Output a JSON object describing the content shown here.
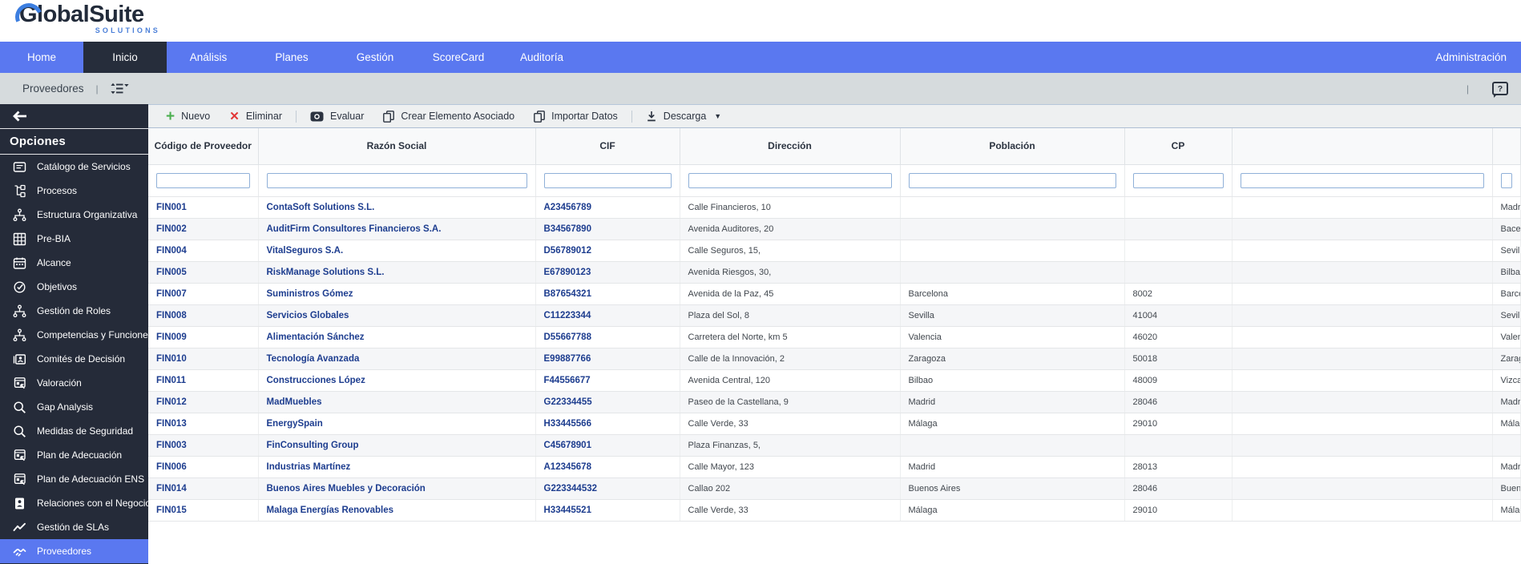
{
  "brand": {
    "name": "GlobalSuite",
    "tagline": "SOLUTIONS"
  },
  "nav": {
    "items": [
      {
        "label": "Home",
        "active": false
      },
      {
        "label": "Inicio",
        "active": true
      },
      {
        "label": "Análisis",
        "active": false
      },
      {
        "label": "Planes",
        "active": false
      },
      {
        "label": "Gestión",
        "active": false
      },
      {
        "label": "ScoreCard",
        "active": false
      },
      {
        "label": "Auditoría",
        "active": false
      }
    ],
    "right_item": "Administración"
  },
  "breadcrumb": {
    "title": "Proveedores"
  },
  "help": {
    "label": "?"
  },
  "toolbar": {
    "buttons": [
      {
        "label": "Nuevo",
        "icon": "plus-icon"
      },
      {
        "label": "Eliminar",
        "icon": "delete-x-icon"
      },
      {
        "label": "Evaluar",
        "icon": "evaluate-icon"
      },
      {
        "label": "Crear Elemento Asociado",
        "icon": "copy-icon"
      },
      {
        "label": "Importar Datos",
        "icon": "copy-icon"
      },
      {
        "label": "Descarga",
        "icon": "download-icon",
        "has_dropdown": true
      }
    ]
  },
  "sidebar": {
    "title": "Opciones",
    "items": [
      {
        "label": "Catálogo de Servicios",
        "icon": "document-icon",
        "selected": false
      },
      {
        "label": "Procesos",
        "icon": "flow-icon",
        "selected": false
      },
      {
        "label": "Estructura Organizativa",
        "icon": "people-tree-icon",
        "selected": false
      },
      {
        "label": "Pre-BIA",
        "icon": "grid-icon",
        "selected": false
      },
      {
        "label": "Alcance",
        "icon": "calendar-icon",
        "selected": false
      },
      {
        "label": "Objetivos",
        "icon": "target-icon",
        "selected": false
      },
      {
        "label": "Gestión de Roles",
        "icon": "people-tree-icon",
        "selected": false
      },
      {
        "label": "Competencias y Funciones",
        "icon": "people-tree-icon",
        "selected": false
      },
      {
        "label": "Comités de Decisión",
        "icon": "id-card-icon",
        "selected": false
      },
      {
        "label": "Valoración",
        "icon": "calendar-cursor-icon",
        "selected": false
      },
      {
        "label": "Gap Analysis",
        "icon": "search-icon",
        "selected": false
      },
      {
        "label": "Medidas de Seguridad",
        "icon": "search-icon",
        "selected": false
      },
      {
        "label": "Plan de Adecuación",
        "icon": "calendar-cursor-icon",
        "selected": false
      },
      {
        "label": "Plan de Adecuación ENS",
        "icon": "calendar-cursor-icon",
        "selected": false
      },
      {
        "label": "Relaciones con el Negocio",
        "icon": "person-badge-icon",
        "selected": false
      },
      {
        "label": "Gestión de SLAs",
        "icon": "trend-icon",
        "selected": false
      },
      {
        "label": "Proveedores",
        "icon": "handshake-icon",
        "selected": true
      }
    ]
  },
  "table": {
    "columns": [
      "Código de Proveedor",
      "Razón Social",
      "CIF",
      "Dirección",
      "Población",
      "CP",
      "",
      ""
    ],
    "rows": [
      [
        "FIN001",
        "ContaSoft Solutions S.L.",
        "A23456789",
        "Calle Financieros, 10",
        "",
        "",
        "",
        "Madrid"
      ],
      [
        "FIN002",
        "AuditFirm Consultores Financieros S.A.",
        "B34567890",
        "Avenida Auditores, 20",
        "",
        "",
        "",
        "Bacelona"
      ],
      [
        "FIN004",
        "VitalSeguros S.A.",
        "D56789012",
        "Calle Seguros, 15,",
        "",
        "",
        "",
        "Sevilla"
      ],
      [
        "FIN005",
        "RiskManage Solutions S.L.",
        "E67890123",
        "Avenida Riesgos, 30,",
        "",
        "",
        "",
        "Bilbao"
      ],
      [
        "FIN007",
        "Suministros Gómez",
        "B87654321",
        "Avenida de la Paz, 45",
        "Barcelona",
        "8002",
        "",
        "Barcelona"
      ],
      [
        "FIN008",
        "Servicios Globales",
        "C11223344",
        "Plaza del Sol, 8",
        "Sevilla",
        "41004",
        "",
        "Sevilla"
      ],
      [
        "FIN009",
        "Alimentación Sánchez",
        "D55667788",
        "Carretera del Norte, km 5",
        "Valencia",
        "46020",
        "",
        "Valencia"
      ],
      [
        "FIN010",
        "Tecnología Avanzada",
        "E99887766",
        "Calle de la Innovación, 2",
        "Zaragoza",
        "50018",
        "",
        "Zaragoza"
      ],
      [
        "FIN011",
        "Construcciones López",
        "F44556677",
        "Avenida Central, 120",
        "Bilbao",
        "48009",
        "",
        "Vizcaya"
      ],
      [
        "FIN012",
        "MadMuebles",
        "G22334455",
        "Paseo de la Castellana, 9",
        "Madrid",
        "28046",
        "",
        "Madrid"
      ],
      [
        "FIN013",
        "EnergySpain",
        "H33445566",
        "Calle Verde, 33",
        "Málaga",
        "29010",
        "",
        "Málaga"
      ],
      [
        "FIN003",
        "FinConsulting Group",
        "C45678901",
        "Plaza Finanzas, 5,",
        "",
        "",
        "",
        ""
      ],
      [
        "FIN006",
        "Industrias Martínez",
        "A12345678",
        "Calle Mayor, 123",
        "Madrid",
        "28013",
        "",
        "Madrid"
      ],
      [
        "FIN014",
        "Buenos Aires Muebles y Decoración",
        "G223344532",
        "Callao 202",
        "Buenos Aires",
        "28046",
        "",
        "Buenos Aires"
      ],
      [
        "FIN015",
        "Malaga Energías Renovables",
        "H33445521",
        "Calle Verde, 33",
        "Málaga",
        "29010",
        "",
        "Málaga"
      ]
    ]
  },
  "colors": {
    "nav_blue": "#5a78f0",
    "nav_active_dark": "#262d3b",
    "sidebar_dark": "#252b39",
    "selected_blue": "#5a78f0",
    "breadcrumb_bg": "#d6dbdd",
    "toolbar_bg": "#eef0f1",
    "table_header_bg": "#f8f9fa",
    "link_text": "#1d3d8f",
    "accent_green": "#4caf50",
    "accent_red": "#e23636",
    "logo_arc_blue": "#3c7ee0"
  }
}
